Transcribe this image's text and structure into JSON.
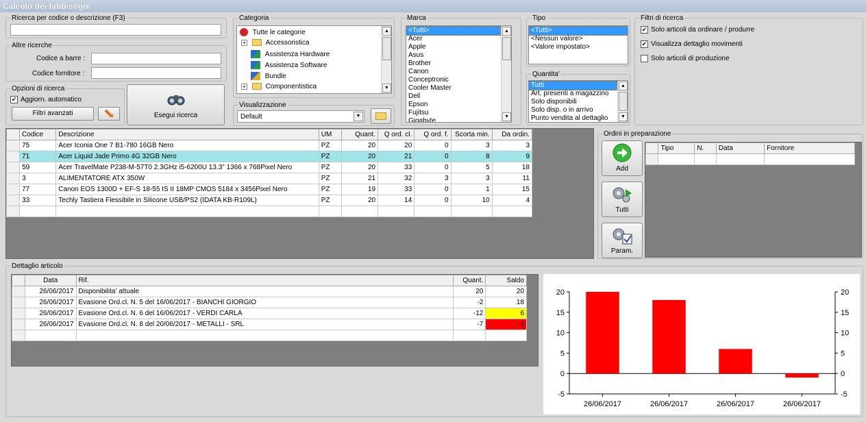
{
  "window": {
    "title": "Calcolo dei fabbisogni"
  },
  "search": {
    "label": "Ricerca per codice o descrizione (F3)",
    "value": ""
  },
  "other_searches": {
    "label": "Altre ricerche",
    "barcode_label": "Codice a barre :",
    "barcode_value": "",
    "supplier_code_label": "Codice fornitore :",
    "supplier_code_value": ""
  },
  "search_options": {
    "label": "Opzioni di ricerca",
    "auto_update_label": "Aggiorn. automatico",
    "auto_update_checked": true,
    "advanced_filters_label": "Filtri avanzati"
  },
  "run_search": {
    "label": "Esegui ricerca"
  },
  "category": {
    "label": "Categoria",
    "items": [
      "Tutte le categorie",
      "Accessoristica",
      "Assistenza Hardware",
      "Assistenza Software",
      "Bundle",
      "Componentistica"
    ]
  },
  "view": {
    "label": "Visualizzazione",
    "value": "Default"
  },
  "brand": {
    "label": "Marca",
    "items": [
      "<Tutti>",
      "Acer",
      "Apple",
      "Asus",
      "Brother",
      "Canon",
      "Conceptronic",
      "Cooler Master",
      "Dell",
      "Epson",
      "Fujitsu",
      "Gigabyte"
    ]
  },
  "type": {
    "label": "Tipo",
    "items": [
      "<Tutti>",
      "<Nessun valore>",
      "<Valore impostato>"
    ]
  },
  "quantity": {
    "label": "Quantita'",
    "items": [
      "Tutti",
      "Art. presenti a magazzino",
      "Solo disponibili",
      "Solo disp. o in arrivo",
      "Punto vendita al dettaglio"
    ]
  },
  "filters": {
    "label": "Filtri di ricerca",
    "items": [
      {
        "label": "Solo articoli da ordinare / produrre",
        "checked": true
      },
      {
        "label": "Visualizza dettaglio movimenti",
        "checked": true
      },
      {
        "label": "Solo articoli di produzione",
        "checked": false
      }
    ]
  },
  "articles": {
    "columns": [
      "Codice",
      "Descrizione",
      "UM",
      "Quant.",
      "Q ord. cl.",
      "Q ord. f.",
      "Scorta min.",
      "Da ordin."
    ],
    "rows": [
      [
        "75",
        "Acer Iconia One 7 B1-780 16GB Nero",
        "PZ",
        "20",
        "20",
        "0",
        "3",
        "3"
      ],
      [
        "71",
        "Acer Liquid Jade Primo 4G 32GB Nero",
        "PZ",
        "20",
        "21",
        "0",
        "8",
        "9"
      ],
      [
        "59",
        "Acer TravelMate P238-M-57T0 2.3GHz i5-6200U 13.3\" 1366 x 768Pixel Nero",
        "PZ",
        "20",
        "33",
        "0",
        "5",
        "18"
      ],
      [
        "3",
        "ALIMENTATORE ATX 350W",
        "PZ",
        "21",
        "32",
        "3",
        "3",
        "11"
      ],
      [
        "77",
        "Canon EOS 1300D + EF-S 18-55 IS II 18MP CMOS 5184 x 3456Pixel Nero",
        "PZ",
        "19",
        "33",
        "0",
        "1",
        "15"
      ],
      [
        "33",
        "Techly Tastiera Flessibile in Silicone USB/PS2 (IDATA KB-R109L)",
        "PZ",
        "20",
        "14",
        "0",
        "10",
        "4"
      ]
    ]
  },
  "orders": {
    "label": "Ordini in preparazione",
    "add_label": "Add",
    "all_label": "Tutti",
    "params_label": "Param.",
    "columns": [
      "Tipo",
      "N.",
      "Data",
      "Fornitore"
    ]
  },
  "detail": {
    "label": "Dettaglio articolo",
    "columns": [
      "Data",
      "Rif.",
      "Quant.",
      "Saldo"
    ],
    "rows": [
      [
        "26/06/2017",
        "Disponibilita' attuale",
        "20",
        "20"
      ],
      [
        "26/06/2017",
        "Evasione Ord.cl. N. 5 del 16/06/2017 - BIANCHI GIORGIO",
        "-2",
        "18"
      ],
      [
        "26/06/2017",
        "Evasione Ord.cl. N. 6 del 16/06/2017 - VERDI CARLA",
        "-12",
        "6"
      ],
      [
        "26/06/2017",
        "Evasione Ord.cl. N. 8 del 20/06/2017 - METALLI - SRL",
        "-7",
        "-1"
      ]
    ],
    "saldo_colors": [
      "",
      "",
      "#ffff00",
      "#ff0000"
    ]
  },
  "chart_data": {
    "type": "bar",
    "categories": [
      "26/06/2017",
      "26/06/2017",
      "26/06/2017",
      "26/06/2017"
    ],
    "values": [
      20,
      18,
      6,
      -1
    ],
    "ylim": [
      -5,
      20
    ],
    "yticks": [
      -5,
      0,
      5,
      10,
      15,
      20
    ],
    "bar_color": "#ff0000",
    "grid": false,
    "dual_y_axis": true
  }
}
